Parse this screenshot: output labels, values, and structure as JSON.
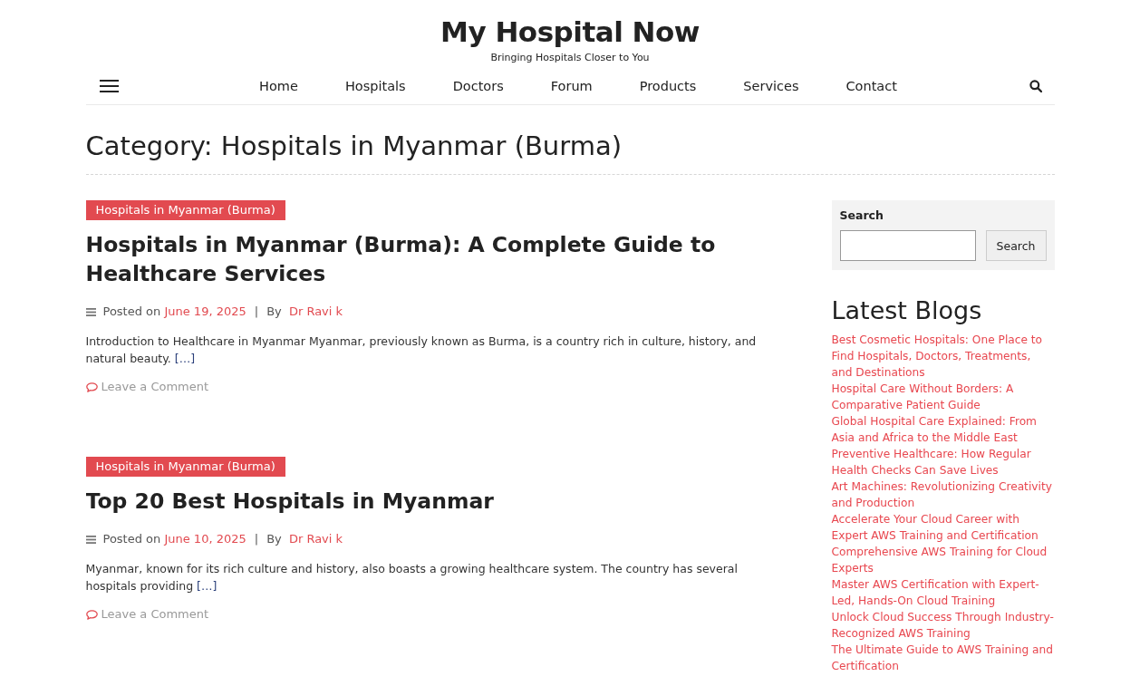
{
  "header": {
    "site_title": "My Hospital Now",
    "tagline": "Bringing Hospitals Closer to You"
  },
  "nav": {
    "items": [
      "Home",
      "Hospitals",
      "Doctors",
      "Forum",
      "Products",
      "Services",
      "Contact"
    ]
  },
  "page_title": "Category: Hospitals in Myanmar (Burma)",
  "posts": [
    {
      "category": "Hospitals in Myanmar (Burma)",
      "title": "Hospitals in Myanmar (Burma): A Complete Guide to Healthcare Services",
      "posted_on": "Posted on",
      "date": "June 19, 2025",
      "separator": "|",
      "by": "By",
      "author": "Dr Ravi k",
      "excerpt": "Introduction to Healthcare in Myanmar Myanmar, previously known as Burma, is a country rich in culture, history, and natural beauty.",
      "read_more": "[…]",
      "comment_link": "Leave a Comment"
    },
    {
      "category": "Hospitals in Myanmar (Burma)",
      "title": "Top 20 Best Hospitals in Myanmar",
      "posted_on": "Posted on",
      "date": "June 10, 2025",
      "separator": "|",
      "by": "By",
      "author": "Dr Ravi k",
      "excerpt": "Myanmar, known for its rich culture and history, also boasts a growing healthcare system. The country has several hospitals providing",
      "read_more": "[…]",
      "comment_link": "Leave a Comment"
    }
  ],
  "sidebar": {
    "search": {
      "label": "Search",
      "button": "Search"
    },
    "latest_blogs": {
      "title": "Latest Blogs",
      "items": [
        "Best Cosmetic Hospitals: One Place to Find Hospitals, Doctors, Treatments, and Destinations",
        "Hospital Care Without Borders: A Comparative Patient Guide",
        "Global Hospital Care Explained: From Asia and Africa to the Middle East",
        "Preventive Healthcare: How Regular Health Checks Can Save Lives",
        "Art Machines: Revolutionizing Creativity and Production",
        "Accelerate Your Cloud Career with Expert AWS Training and Certification",
        "Comprehensive AWS Training for Cloud Experts",
        "Master AWS Certification with Expert-Led, Hands-On Cloud Training",
        "Unlock Cloud Success Through Industry-Recognized AWS Training",
        "The Ultimate Guide to AWS Training and Certification"
      ]
    }
  }
}
